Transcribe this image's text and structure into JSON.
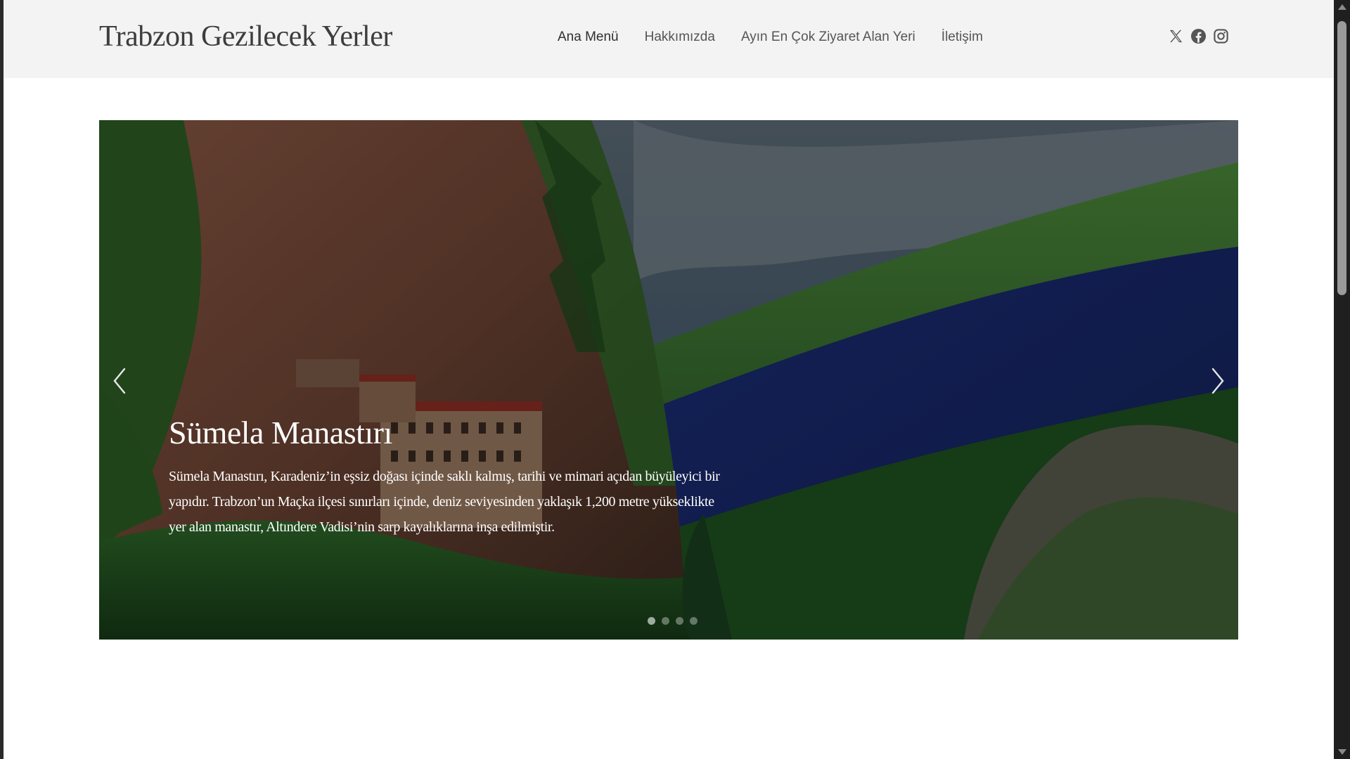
{
  "header": {
    "site_title": "Trabzon Gezilecek Yerler",
    "nav": [
      {
        "label": "Ana Menü",
        "active": true
      },
      {
        "label": "Hakkımızda"
      },
      {
        "label": "Ayın En Çok Ziyaret Alan Yeri"
      },
      {
        "label": "İletişim"
      }
    ],
    "social_icons": [
      "x-icon",
      "facebook-icon",
      "instagram-icon"
    ]
  },
  "slider": {
    "slides_count": 4,
    "active_index": 0,
    "current": {
      "title": "Sümela Manastırı",
      "text": "Sümela Manastırı, Karadeniz’in eşsiz doğası içinde saklı kalmış, tarihi ve mimari açıdan büyüleyici bir yapıdır. Trabzon’un Maçka ilçesi sınırları içinde, deniz seviyesinden yaklaşık 1,200 metre yükseklikte yer alan manastır, Altındere Vadisi’nin sarp kayalıklarına inşa edilmiştir."
    },
    "controls": {
      "prev": "chevron-left-icon",
      "next": "chevron-right-icon"
    }
  },
  "colors": {
    "header_bg": "#f3f3f3",
    "title_text": "#3d3d3d",
    "nav_text": "#555555",
    "caption_text": "#ffffff"
  }
}
